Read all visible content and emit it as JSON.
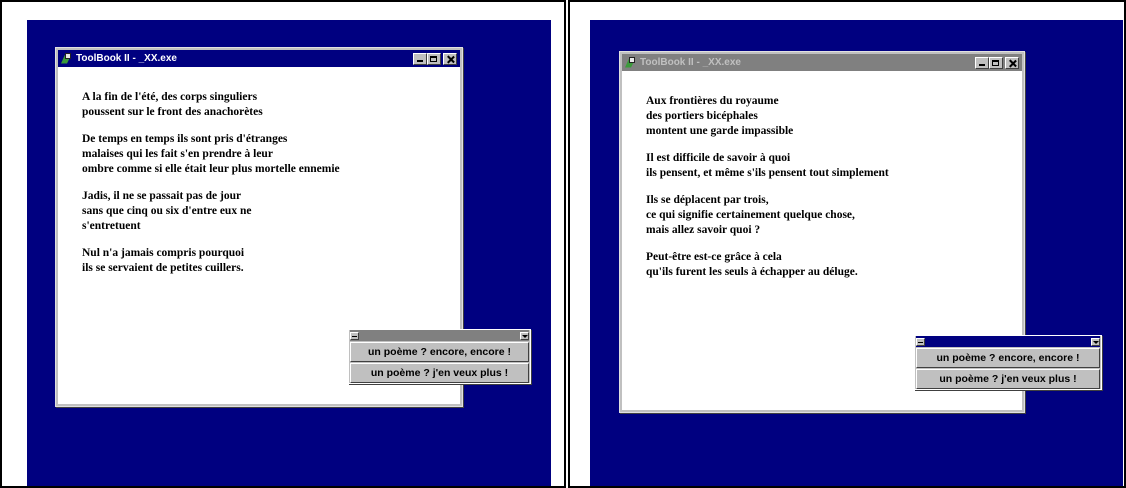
{
  "left": {
    "window_title": "ToolBook II - _XX.exe",
    "stanzas": [
      [
        "A la fin de l'été, des corps singuliers",
        "poussent sur le front des anachorètes"
      ],
      [
        "De temps en temps ils sont pris d'étranges",
        "malaises qui les fait s'en prendre à leur",
        "ombre comme si elle était leur plus mortelle ennemie"
      ],
      [
        "Jadis, il ne se passait pas de jour",
        "sans que cinq ou six d'entre eux ne",
        "s'entretuent"
      ],
      [
        "Nul n'a jamais compris pourquoi",
        "ils se servaient de petites cuillers."
      ]
    ],
    "buttons": [
      "un poème ? encore, encore !",
      "un poème ? j'en veux plus !"
    ],
    "active": false
  },
  "right": {
    "window_title": "ToolBook II - _XX.exe",
    "stanzas": [
      [
        "Aux frontières du royaume",
        "des portiers bicéphales",
        "montent une garde impassible"
      ],
      [
        "Il est difficile de savoir à quoi",
        "ils pensent, et même s'ils pensent tout simplement"
      ],
      [
        "Ils se déplacent par trois,",
        "ce qui signifie certainement quelque chose,",
        "mais allez savoir quoi ?"
      ],
      [
        "Peut-être est-ce grâce à cela",
        "qu'ils furent les seuls à échapper au déluge."
      ]
    ],
    "buttons": [
      "un poème ? encore, encore !",
      "un poème ? j'en veux plus !"
    ],
    "active": true
  },
  "colors": {
    "desktop": "#000080",
    "window_face": "#c0c0c0",
    "titlebar_active": "#000080",
    "titlebar_inactive": "#808080"
  },
  "icons": {
    "app": "toolbook-app-icon",
    "minimize": "minimize-icon",
    "maximize": "maximize-icon",
    "close": "close-icon",
    "palette_menu": "palette-menu-icon",
    "palette_collapse": "chevron-down-icon"
  }
}
